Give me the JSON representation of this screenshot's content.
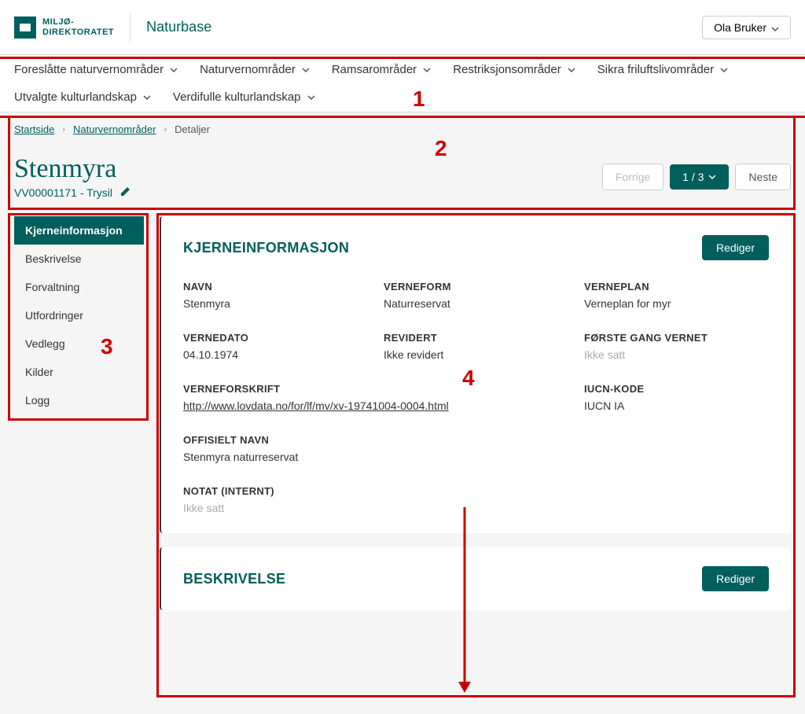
{
  "header": {
    "logo_line1": "MILJØ-",
    "logo_line2": "DIREKTORATET",
    "app_name": "Naturbase",
    "user_label": "Ola Bruker"
  },
  "nav": {
    "items": [
      {
        "label": "Foreslåtte naturvernområder"
      },
      {
        "label": "Naturvernområder"
      },
      {
        "label": "Ramsarområder"
      },
      {
        "label": "Restriksjonsområder"
      },
      {
        "label": "Sikra friluftslivområder"
      },
      {
        "label": "Utvalgte kulturlandskap"
      },
      {
        "label": "Verdifulle kulturlandskap"
      }
    ]
  },
  "breadcrumb": {
    "home": "Startside",
    "section": "Naturvernområder",
    "current": "Detaljer"
  },
  "page": {
    "title": "Stenmyra",
    "subtitle": "VV00001171 - Trysil",
    "pager": {
      "prev": "Forrige",
      "count": "1 / 3",
      "next": "Neste"
    }
  },
  "sidebar": {
    "items": [
      {
        "label": "Kjerneinformasjon",
        "active": true
      },
      {
        "label": "Beskrivelse",
        "active": false
      },
      {
        "label": "Forvaltning",
        "active": false
      },
      {
        "label": "Utfordringer",
        "active": false
      },
      {
        "label": "Vedlegg",
        "active": false
      },
      {
        "label": "Kilder",
        "active": false
      },
      {
        "label": "Logg",
        "active": false
      }
    ]
  },
  "panels": {
    "core": {
      "title": "KJERNEINFORMASJON",
      "edit": "Rediger",
      "fields": {
        "navn": {
          "label": "NAVN",
          "value": "Stenmyra"
        },
        "verneform": {
          "label": "VERNEFORM",
          "value": "Naturreservat"
        },
        "verneplan": {
          "label": "VERNEPLAN",
          "value": "Verneplan for myr"
        },
        "vernedato": {
          "label": "VERNEDATO",
          "value": "04.10.1974"
        },
        "revidert": {
          "label": "REVIDERT",
          "value": "Ikke revidert"
        },
        "forste": {
          "label": "FØRSTE GANG VERNET",
          "value": "Ikke satt",
          "muted": true
        },
        "verneforskrift": {
          "label": "VERNEFORSKRIFT",
          "value": "http://www.lovdata.no/for/lf/mv/xv-19741004-0004.html"
        },
        "iucn": {
          "label": "IUCN-KODE",
          "value": "IUCN IA"
        },
        "offisielt": {
          "label": "OFFISIELT NAVN",
          "value": "Stenmyra naturreservat"
        },
        "notat": {
          "label": "NOTAT (INTERNT)",
          "value": "Ikke satt",
          "muted": true
        }
      }
    },
    "beskrivelse": {
      "title": "BESKRIVELSE",
      "edit": "Rediger"
    }
  },
  "annotations": {
    "n1": "1",
    "n2": "2",
    "n3": "3",
    "n4": "4"
  }
}
